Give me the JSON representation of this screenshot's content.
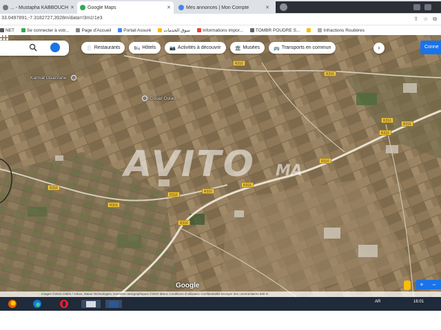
{
  "browser": {
    "tabs": [
      {
        "title": "... - Mustapha KABBOUCH",
        "active": false
      },
      {
        "title": "Google Maps",
        "active": true
      },
      {
        "title": "Mes annonces | Mon Compte",
        "active": false
      }
    ],
    "new_tab_glyph": "+",
    "address": "33.0497891,-7.3182727,3928m/data=!3m1!1e3",
    "bookmarks": [
      {
        "label": "NET",
        "color": "#555555"
      },
      {
        "label": "Se connecter à votr...",
        "color": "#34a853"
      },
      {
        "label": "Page d'Accueil",
        "color": "#888888"
      },
      {
        "label": "Portail Assuré",
        "color": "#4285f4"
      },
      {
        "label": "سوق الخدمات",
        "color": "#fbbc04"
      },
      {
        "label": "Informations impor...",
        "color": "#ea4335"
      },
      {
        "label": "TOMBR POUDRE S...",
        "color": "#666666"
      },
      {
        "label": "",
        "color": "#fbbc04"
      },
      {
        "label": "Infractions Routières",
        "color": "#aaaaaa"
      }
    ]
  },
  "map": {
    "chips": [
      {
        "icon": "fork-knife-icon",
        "glyph": "🍴",
        "label": "Restaurants"
      },
      {
        "icon": "bed-icon",
        "glyph": "🛏",
        "label": "Hôtels"
      },
      {
        "icon": "camera-icon",
        "glyph": "📷",
        "label": "Activités à découvrir"
      },
      {
        "icon": "museum-icon",
        "glyph": "🏛",
        "label": "Musées"
      },
      {
        "icon": "bus-icon",
        "glyph": "🚌",
        "label": "Transports en commun"
      }
    ],
    "chip_more_glyph": "›",
    "connect_label": "Conne",
    "places": [
      {
        "label": "Karmat Ouazzane"
      },
      {
        "label": "Douar Oulad ..."
      }
    ],
    "road_labels": [
      "R316",
      "R316",
      "R316",
      "R316",
      "R316",
      "R316",
      "R316",
      "R316",
      "R316",
      "R316",
      "R316",
      "R316"
    ],
    "watermark": "AVITO",
    "watermark_suffix": "MA",
    "google_logo": "Google",
    "zoom_in": "+",
    "zoom_out": "−",
    "attribution": "Images ©2023 CNES / Airbus, Maxar Technologies, Données cartographiques ©2023   Maroc   Conditions d'utilisation   Confidentialité   Envoyer des commentaires   500 m"
  },
  "taskbar": {
    "apps": [
      "firefox-icon",
      "edge-icon",
      "opera-icon",
      "file-explorer-icon",
      "word-icon"
    ],
    "time": "16:01",
    "date": "AR"
  },
  "colors": {
    "accent": "#1a73e8",
    "road": "#f2c744",
    "field": "#8f7a5c"
  }
}
